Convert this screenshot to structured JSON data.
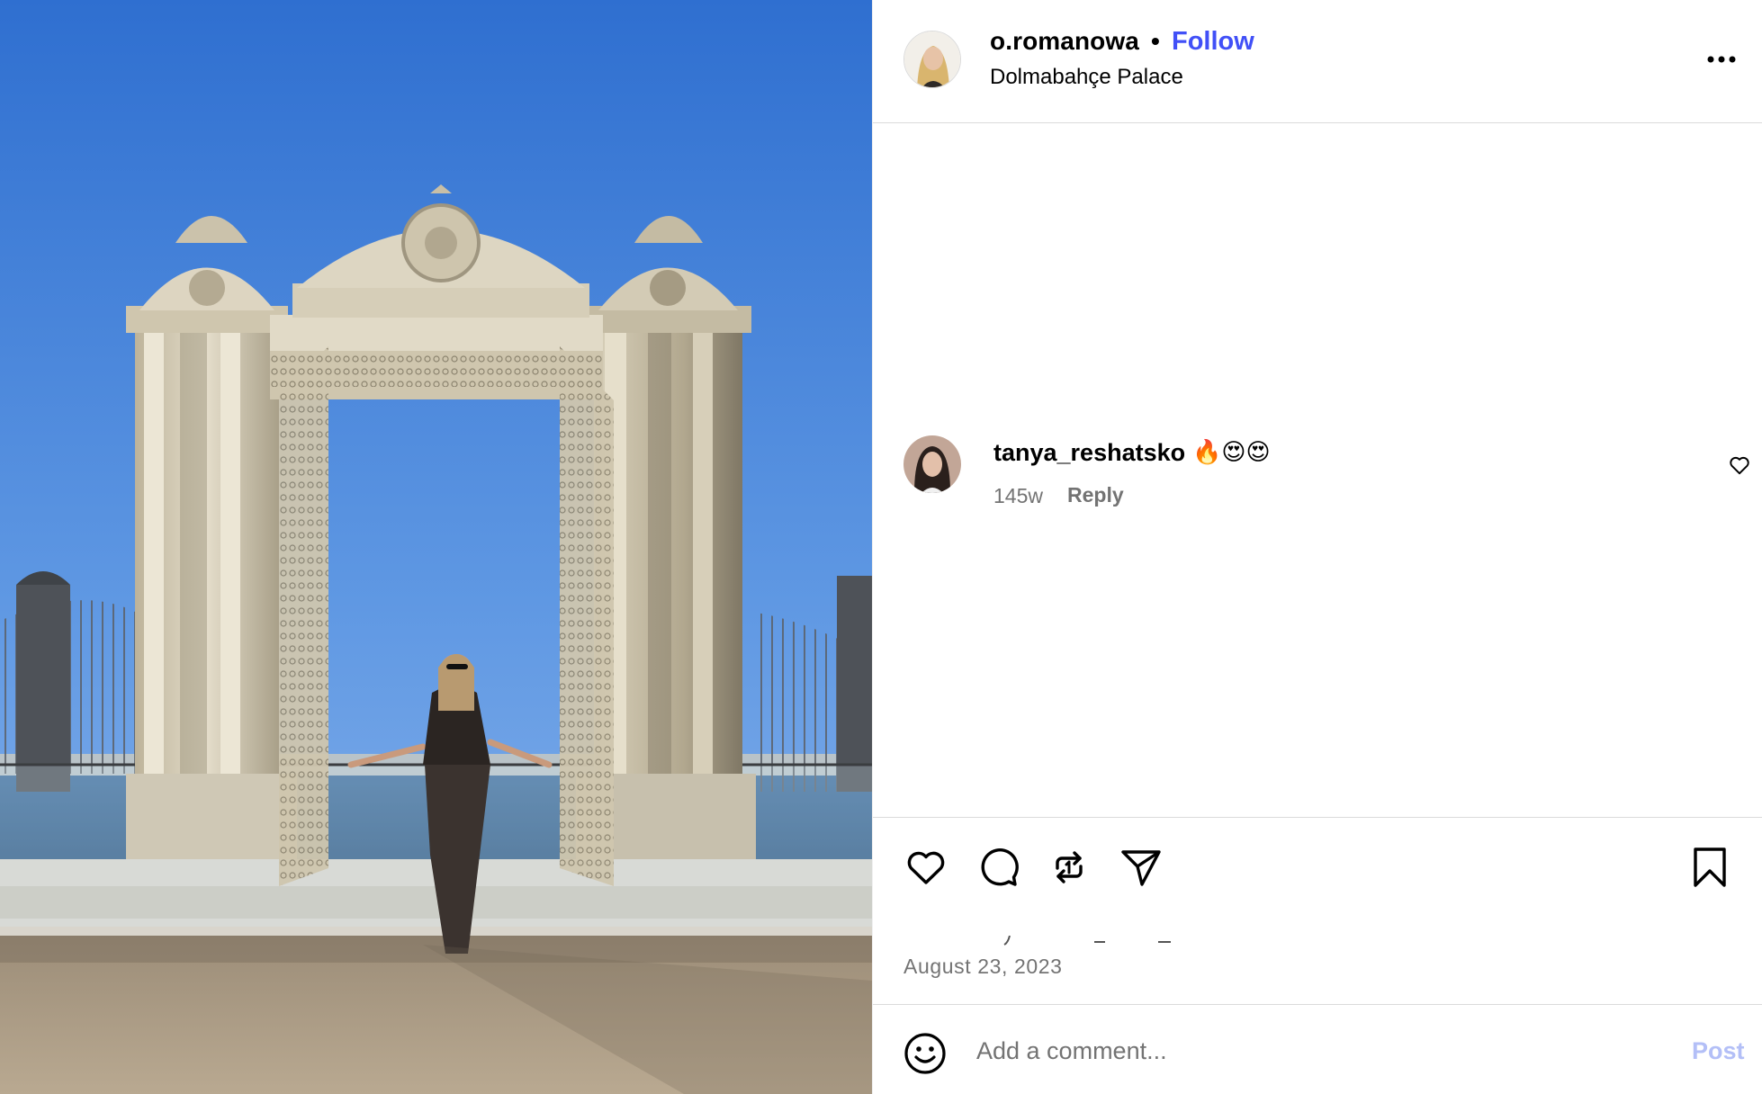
{
  "header": {
    "username": "o.romanowa",
    "separator": "•",
    "follow_label": "Follow",
    "location": "Dolmabahçe Palace"
  },
  "comments": [
    {
      "username": "tanya_reshatsko",
      "text": "🔥😍😍",
      "age": "145w",
      "reply_label": "Reply"
    }
  ],
  "post": {
    "date": "August 23, 2023"
  },
  "composer": {
    "placeholder": "Add a comment...",
    "post_label": "Post"
  },
  "icons": {
    "more": "more-horizontal-icon",
    "like": "heart-icon",
    "comment": "comment-bubble-icon",
    "repost": "repost-icon",
    "share": "paper-plane-icon",
    "save": "bookmark-icon",
    "emoji": "emoji-smiley-icon"
  },
  "colors": {
    "follow": "#4150f7",
    "post_button_disabled": "#b3bff7",
    "secondary_text": "#737373",
    "divider": "#dbdbdb"
  }
}
